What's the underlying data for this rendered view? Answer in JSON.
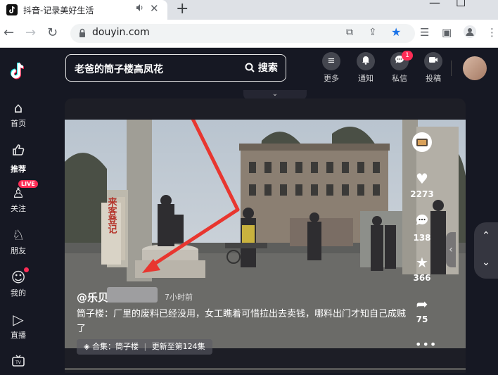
{
  "browser": {
    "tab_title": "抖音-记录美好生活",
    "audio_icon": "speaker-icon",
    "close_glyph": "✕",
    "newtab_glyph": "+",
    "url": "douyin.com",
    "back_glyph": "←",
    "forward_glyph": "→",
    "reload_glyph": "↻",
    "open_glyph": "⧉",
    "share_glyph": "⇪",
    "star_glyph": "★",
    "star_color": "#1a73e8",
    "queue_glyph": "☰",
    "panel_glyph": "▣",
    "profile_glyph": "●",
    "menu_glyph": "⋮",
    "minimize_glyph": "—",
    "maximize_glyph": "☐"
  },
  "sidebar": {
    "items": [
      {
        "label": "首页",
        "icon": "home-icon",
        "glyph": "⌂"
      },
      {
        "label": "推荐",
        "icon": "thumbs-up-icon",
        "glyph": "👍"
      },
      {
        "label": "关注",
        "icon": "follow-icon",
        "glyph": "♙"
      },
      {
        "label": "朋友",
        "icon": "friends-icon",
        "glyph": "♘"
      },
      {
        "label": "我的",
        "icon": "user-icon",
        "glyph": "☺"
      },
      {
        "label": "直播",
        "icon": "live-icon",
        "glyph": "▷"
      },
      {
        "label": "",
        "icon": "tv-icon",
        "glyph": "▭"
      }
    ],
    "live_badge": "LIVE"
  },
  "header": {
    "search_value": "老爸的筒子楼高凤花",
    "search_button": "搜索",
    "items": [
      {
        "label": "更多",
        "icon": "more-icon",
        "glyph": "≡"
      },
      {
        "label": "通知",
        "icon": "bell-icon",
        "glyph": "♪"
      },
      {
        "label": "私信",
        "icon": "message-icon",
        "glyph": "✉"
      },
      {
        "label": "投稿",
        "icon": "upload-icon",
        "glyph": "▶"
      }
    ],
    "message_badge": "1",
    "collapse_glyph": "⌄"
  },
  "video": {
    "author": "@乐贝",
    "posted": "7小时前",
    "description": "筒子楼：厂里的废料已经没用，女工瞧着可惜拉出去卖钱，哪料出门才知自己成贼了",
    "collection_label": "合集：筒子楼",
    "collection_update": "更新至第124集",
    "collection_glyph": "◈",
    "likes": "2273",
    "comments": "138",
    "favorites": "366",
    "shares": "75",
    "like_glyph": "♥",
    "comment_glyph": "●",
    "favorite_glyph": "★",
    "share_glyph": "➦",
    "more_glyph": "•••",
    "sign_text": "来客登记",
    "pager_up": "⌃",
    "pager_down": "⌄",
    "side_arrow": "‹"
  },
  "colors": {
    "accent": "#fe2c55",
    "bg": "#161823",
    "arrow": "#e8362f"
  }
}
